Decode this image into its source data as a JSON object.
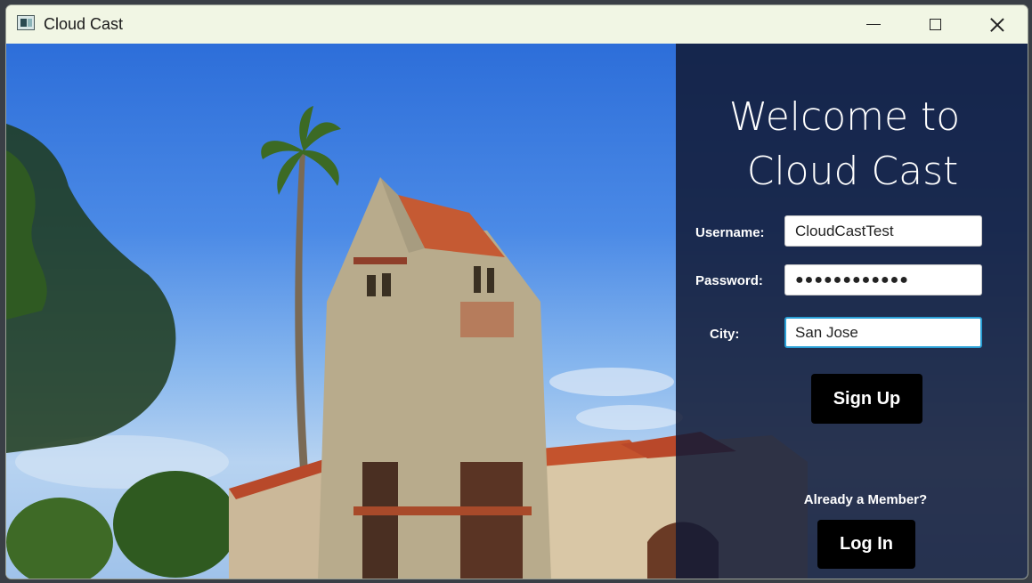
{
  "window": {
    "title": "Cloud Cast"
  },
  "welcome": {
    "line1": "Welcome to",
    "line2": "Cloud Cast"
  },
  "form": {
    "username_label": "Username:",
    "username_value": "CloudCastTest",
    "password_label": "Password:",
    "password_value": "●●●●●●●●●●●●",
    "city_label": "City:",
    "city_value": "San Jose"
  },
  "buttons": {
    "signup": "Sign Up",
    "login": "Log In"
  },
  "already_member": "Already a Member?"
}
